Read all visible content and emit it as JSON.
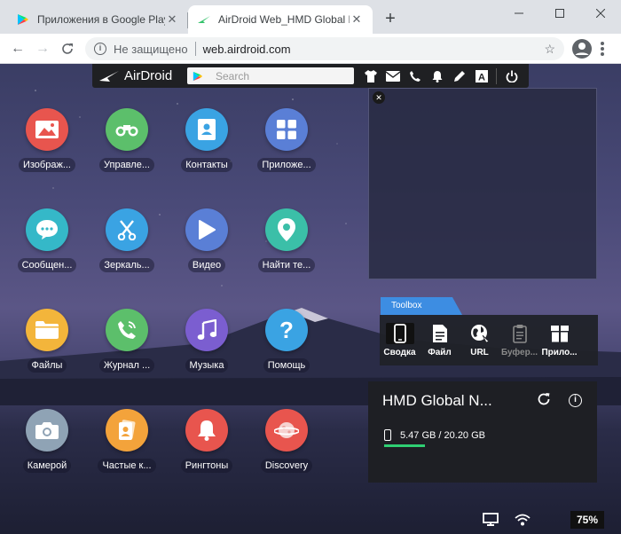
{
  "browser": {
    "tabs": [
      {
        "title": "Приложения в Google Play – Air",
        "active": false
      },
      {
        "title": "AirDroid Web_HMD Global Nokia",
        "active": true
      }
    ],
    "new_tab_label": "+",
    "url_security": "Не защищено",
    "url": "web.airdroid.com"
  },
  "airdroid": {
    "logo_text": "AirDroid",
    "search_placeholder": "Search",
    "top_icons": [
      "tshirt-icon",
      "mail-icon",
      "phone-icon",
      "bell-icon",
      "pen-icon",
      "font-icon",
      "power-icon"
    ]
  },
  "apps": [
    {
      "label": "Изображ...",
      "icon": "image-icon",
      "color": "#e8554e"
    },
    {
      "label": "Управле...",
      "icon": "binoculars-icon",
      "color": "#5cbf6b"
    },
    {
      "label": "Контакты",
      "icon": "contacts-icon",
      "color": "#3aa3e3"
    },
    {
      "label": "Приложе...",
      "icon": "grid-icon",
      "color": "#5a7fd6"
    },
    {
      "label": "Сообщен...",
      "icon": "message-icon",
      "color": "#35b8c8"
    },
    {
      "label": "Зеркаль...",
      "icon": "scissors-icon",
      "color": "#3aa3e3"
    },
    {
      "label": "Видео",
      "icon": "play-icon",
      "color": "#5a7fd6"
    },
    {
      "label": "Найти те...",
      "icon": "location-icon",
      "color": "#3bbfa8"
    },
    {
      "label": "Файлы",
      "icon": "folder-icon",
      "color": "#f3b53b"
    },
    {
      "label": "Журнал ...",
      "icon": "call-log-icon",
      "color": "#5cbf6b"
    },
    {
      "label": "Музыка",
      "icon": "music-icon",
      "color": "#7b5ed0"
    },
    {
      "label": "Помощь",
      "icon": "help-icon",
      "color": "#3aa3e3"
    },
    {
      "label": "Камерой",
      "icon": "camera-icon",
      "color": "#8fa3b5"
    },
    {
      "label": "Частые к...",
      "icon": "frequent-contacts-icon",
      "color": "#f3a33b"
    },
    {
      "label": "Рингтоны",
      "icon": "ringtone-bell-icon",
      "color": "#e8554e"
    },
    {
      "label": "Discovery",
      "icon": "planet-icon",
      "color": "#e8554e"
    }
  ],
  "toolbox": {
    "tab_label": "Toolbox",
    "items": [
      {
        "label": "Сводка",
        "icon": "phone-outline-icon",
        "selected": true
      },
      {
        "label": "Файл",
        "icon": "file-icon",
        "selected": false
      },
      {
        "label": "URL",
        "icon": "globe-icon",
        "selected": false
      },
      {
        "label": "Буфер...",
        "icon": "clipboard-icon",
        "selected": false
      },
      {
        "label": "Прило...",
        "icon": "app-box-icon",
        "selected": false
      }
    ]
  },
  "device": {
    "name": "HMD Global N...",
    "storage": "5.47 GB / 20.20 GB",
    "storage_used_fraction": 0.27
  },
  "status": {
    "battery": "75%"
  },
  "colors": {
    "accent": "#3d8de2",
    "storage_bar": "#2fcf73"
  }
}
